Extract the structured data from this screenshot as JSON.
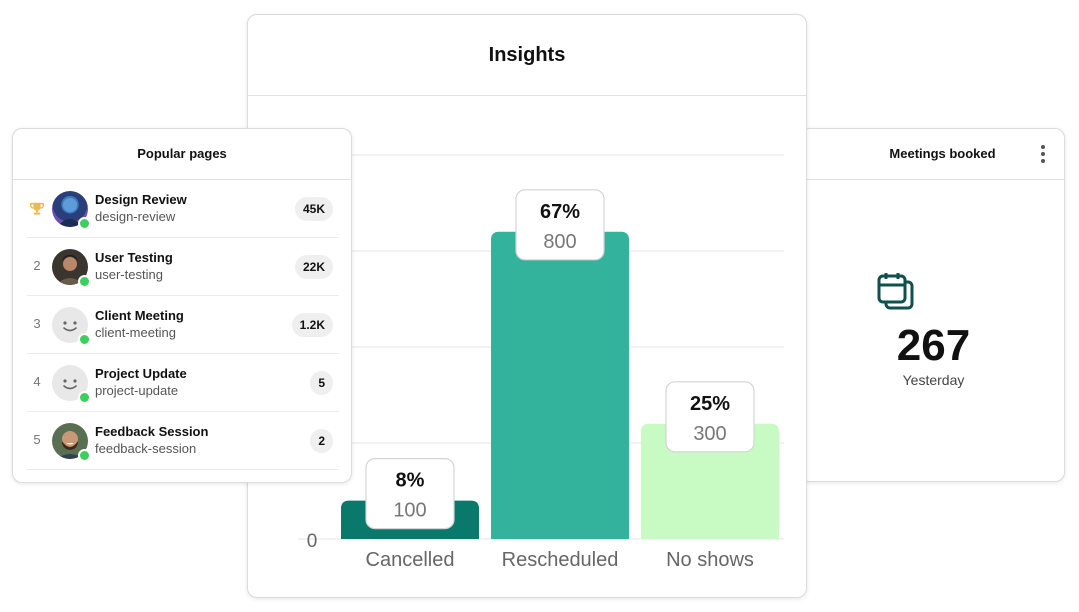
{
  "insights": {
    "title": "Insights"
  },
  "chart_data": {
    "type": "bar",
    "categories": [
      "Cancelled",
      "Rescheduled",
      "No shows"
    ],
    "values": [
      100,
      800,
      300
    ],
    "percent_labels": [
      "8%",
      "67%",
      "25%"
    ],
    "value_labels": [
      "100",
      "800",
      "300"
    ],
    "colors": [
      "#08796B",
      "#33B39C",
      "#C8FAC4"
    ],
    "y_tick_labels": [
      "0"
    ],
    "ylim": [
      0,
      1000
    ],
    "grid": true
  },
  "popular": {
    "title": "Popular pages",
    "rows": [
      {
        "rank": "",
        "rank_icon": "trophy-icon",
        "name": "Design Review",
        "slug": "design-review",
        "count": "45K",
        "avatar": "photo-blue"
      },
      {
        "rank": "2",
        "name": "User Testing",
        "slug": "user-testing",
        "count": "22K",
        "avatar": "photo-dark"
      },
      {
        "rank": "3",
        "name": "Client Meeting",
        "slug": "client-meeting",
        "count": "1.2K",
        "avatar": "placeholder-smile"
      },
      {
        "rank": "4",
        "name": "Project Update",
        "slug": "project-update",
        "count": "5",
        "avatar": "placeholder-smile"
      },
      {
        "rank": "5",
        "name": "Feedback Session",
        "slug": "feedback-session",
        "count": "2",
        "avatar": "photo-laugh"
      }
    ]
  },
  "meetings": {
    "title": "Meetings booked",
    "value": "267",
    "label": "Yesterday",
    "icon": "calendar-stack-icon",
    "icon_color": "#0F4F4C"
  }
}
